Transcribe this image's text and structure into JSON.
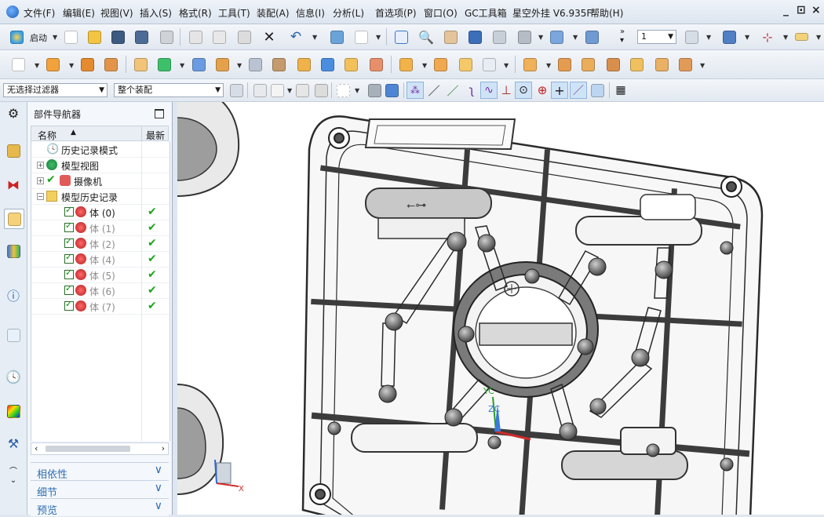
{
  "menubar": {
    "items": [
      "文件(F)",
      "编辑(E)",
      "视图(V)",
      "插入(S)",
      "格式(R)",
      "工具(T)",
      "装配(A)",
      "信息(I)",
      "分析(L)",
      "首选项(P)",
      "窗口(O)",
      "GC工具箱",
      "星空外挂 V6.935F",
      "帮助(H)"
    ],
    "window_controls": [
      "_",
      "⊡",
      "×"
    ]
  },
  "toolbar": {
    "start_label": "启动",
    "layer_value": "1",
    "selection_filter": "无选择过滤器",
    "assembly_scope": "整个装配"
  },
  "navigator": {
    "title": "部件导航器",
    "col_name": "名称",
    "col_latest": "最新",
    "nodes": [
      {
        "label": "历史记录模式",
        "icon": "clock-icon",
        "level": 0
      },
      {
        "label": "模型视图",
        "icon": "model-view-icon",
        "level": 0,
        "expander": "+"
      },
      {
        "label": "摄像机",
        "icon": "camera-icon",
        "level": 0,
        "expander": "+"
      },
      {
        "label": "模型历史记录",
        "icon": "folder-icon",
        "level": 0,
        "expander": "−"
      },
      {
        "label": "体 (0)",
        "level": 1,
        "dim": false,
        "latest": "✔"
      },
      {
        "label": "体 (1)",
        "level": 1,
        "dim": true,
        "latest": "✔"
      },
      {
        "label": "体 (2)",
        "level": 1,
        "dim": true,
        "latest": "✔"
      },
      {
        "label": "体 (4)",
        "level": 1,
        "dim": true,
        "latest": "✔"
      },
      {
        "label": "体 (5)",
        "level": 1,
        "dim": true,
        "latest": "✔"
      },
      {
        "label": "体 (6)",
        "level": 1,
        "dim": true,
        "latest": "✔"
      },
      {
        "label": "体 (7)",
        "level": 1,
        "dim": true,
        "latest": "✔"
      }
    ],
    "sections": [
      "相依性",
      "细节",
      "预览"
    ]
  },
  "viewport": {
    "axis_labels": {
      "yc": "YC",
      "zc": "ZC",
      "x": "X"
    }
  },
  "colors": {
    "menubar": "#e6edf5",
    "accent": "#2f6fb2",
    "check_green": "#1ca51c",
    "model_gray": "#9a9a9a"
  }
}
